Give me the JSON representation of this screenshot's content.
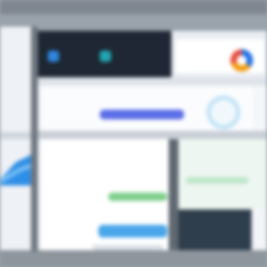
{
  "screen": {
    "accent_colors": {
      "nav_dark": "#1e2733",
      "hero_line": "#5b6ee8",
      "green_line": "#7fcf8e",
      "blue_line": "#4aa6ea",
      "ring": "#bfe3f5"
    },
    "icons": {
      "nav_icon_1": "app-icon",
      "nav_icon_2": "app-icon",
      "app_logo": "app-logo-icon"
    }
  }
}
